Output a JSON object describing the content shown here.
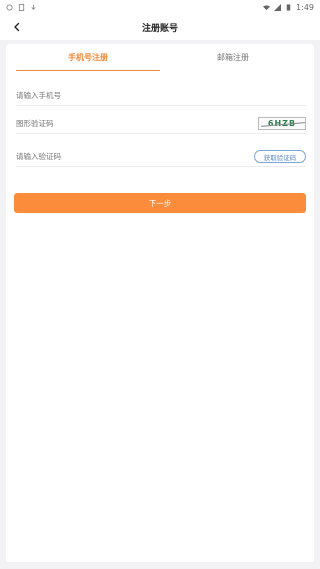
{
  "status_bar": {
    "time": "1:49",
    "icons": [
      "notification-icon",
      "sim-icon",
      "download-icon",
      "wifi-icon",
      "signal-icon",
      "battery-icon"
    ]
  },
  "header": {
    "title": "注册账号",
    "back_icon": "chevron-left-icon"
  },
  "tabs": [
    {
      "label": "手机号注册",
      "active": true
    },
    {
      "label": "邮箱注册",
      "active": false
    }
  ],
  "form": {
    "phone_placeholder": "请输入手机号",
    "captcha_placeholder": "图形验证码",
    "captcha_text": "6HZB",
    "code_placeholder": "请输入验证码",
    "get_code_label": "获取验证码",
    "next_label": "下一步"
  },
  "colors": {
    "accent": "#fb8c3c",
    "link_blue": "#5b86c4",
    "background": "#f2f2f4"
  }
}
